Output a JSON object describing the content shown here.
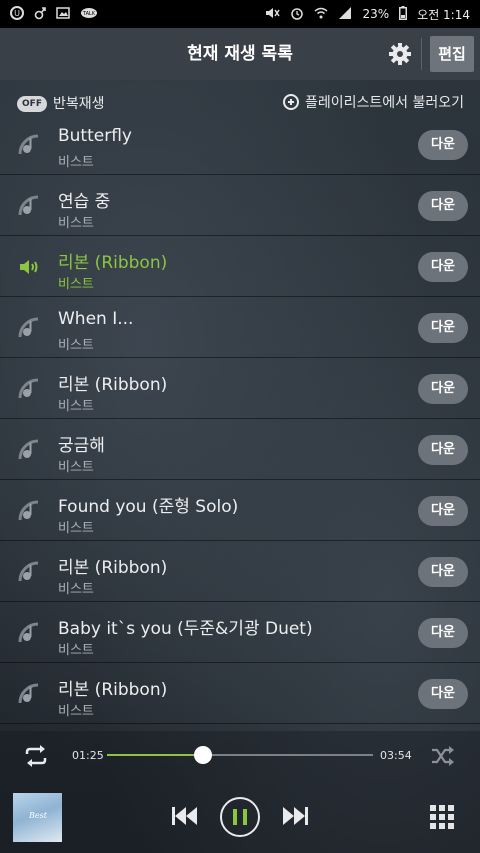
{
  "status_bar": {
    "battery": "23%",
    "time": "오전 1:14",
    "talk_badge": "TALK"
  },
  "header": {
    "title": "현재 재생 목록",
    "edit_label": "편집"
  },
  "subbar": {
    "repeat_toggle": "OFF",
    "repeat_label": "반복재생",
    "load_label": "플레이리스트에서 불러오기"
  },
  "tracks": [
    {
      "title": "Butterfly",
      "artist": "비스트",
      "action": "다운"
    },
    {
      "title": "연습 중",
      "artist": "비스트",
      "action": "다운"
    },
    {
      "title": "리본 (Ribbon)",
      "artist": "비스트",
      "action": "다운",
      "playing": true
    },
    {
      "title": "When I...",
      "artist": "비스트",
      "action": "다운"
    },
    {
      "title": "리본 (Ribbon)",
      "artist": "비스트",
      "action": "다운"
    },
    {
      "title": "궁금해",
      "artist": "비스트",
      "action": "다운"
    },
    {
      "title": "Found you (준형 Solo)",
      "artist": "비스트",
      "action": "다운"
    },
    {
      "title": "리본 (Ribbon)",
      "artist": "비스트",
      "action": "다운"
    },
    {
      "title": "Baby it`s you (두준&기광 Duet)",
      "artist": "비스트",
      "action": "다운"
    },
    {
      "title": "리본 (Ribbon)",
      "artist": "비스트",
      "action": "다운"
    }
  ],
  "player": {
    "current_time": "01:25",
    "total_time": "03:54",
    "progress": 0.36,
    "album_text": "Best"
  },
  "colors": {
    "accent": "#8cc63f",
    "header_bg": "#3a4048",
    "button_bg": "#6c737a"
  },
  "icons": {
    "status_left": [
      "u-plus-icon",
      "bluetooth-icon",
      "gallery-icon",
      "talk-icon"
    ],
    "status_right": [
      "mute-icon",
      "alarm-icon",
      "wifi-icon",
      "signal-icon",
      "battery-icon"
    ],
    "header": [
      "gear-icon"
    ],
    "row": [
      "speaker-icon",
      "note-icon"
    ],
    "player": [
      "repeat-icon",
      "shuffle-icon",
      "previous-icon",
      "pause-icon",
      "next-icon",
      "grid-icon"
    ]
  }
}
